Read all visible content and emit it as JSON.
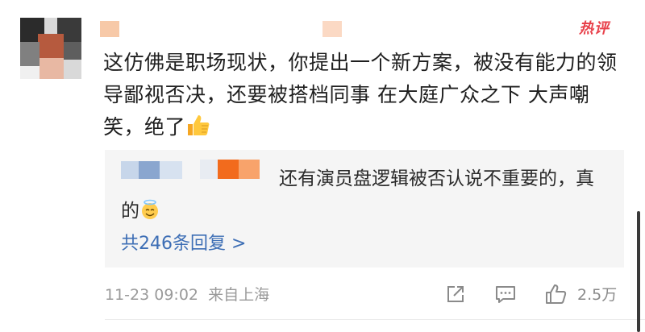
{
  "comment": {
    "badge": "热评",
    "text": "这仿佛是职场现状，你提出一个新方案，被没有能力的领导鄙视否决，还要被搭档同事 在大庭广众之下 大声嘲笑，绝了",
    "emoji": "thumbs-up"
  },
  "reply": {
    "text": "还有演员盘逻辑被否认说不重要的，真的",
    "emoji": "smiling-face-with-halo",
    "count_label": "共246条回复 >"
  },
  "footer": {
    "timestamp": "11-23 09:02",
    "location": "来自上海",
    "like_count": "2.5万"
  },
  "icons": [
    "share-icon",
    "comment-icon",
    "like-icon"
  ],
  "colors": {
    "link": "#3d6eb5",
    "badge": "#e8404a",
    "reply_bg": "#f5f5f5",
    "meta": "#9a9a9a"
  }
}
